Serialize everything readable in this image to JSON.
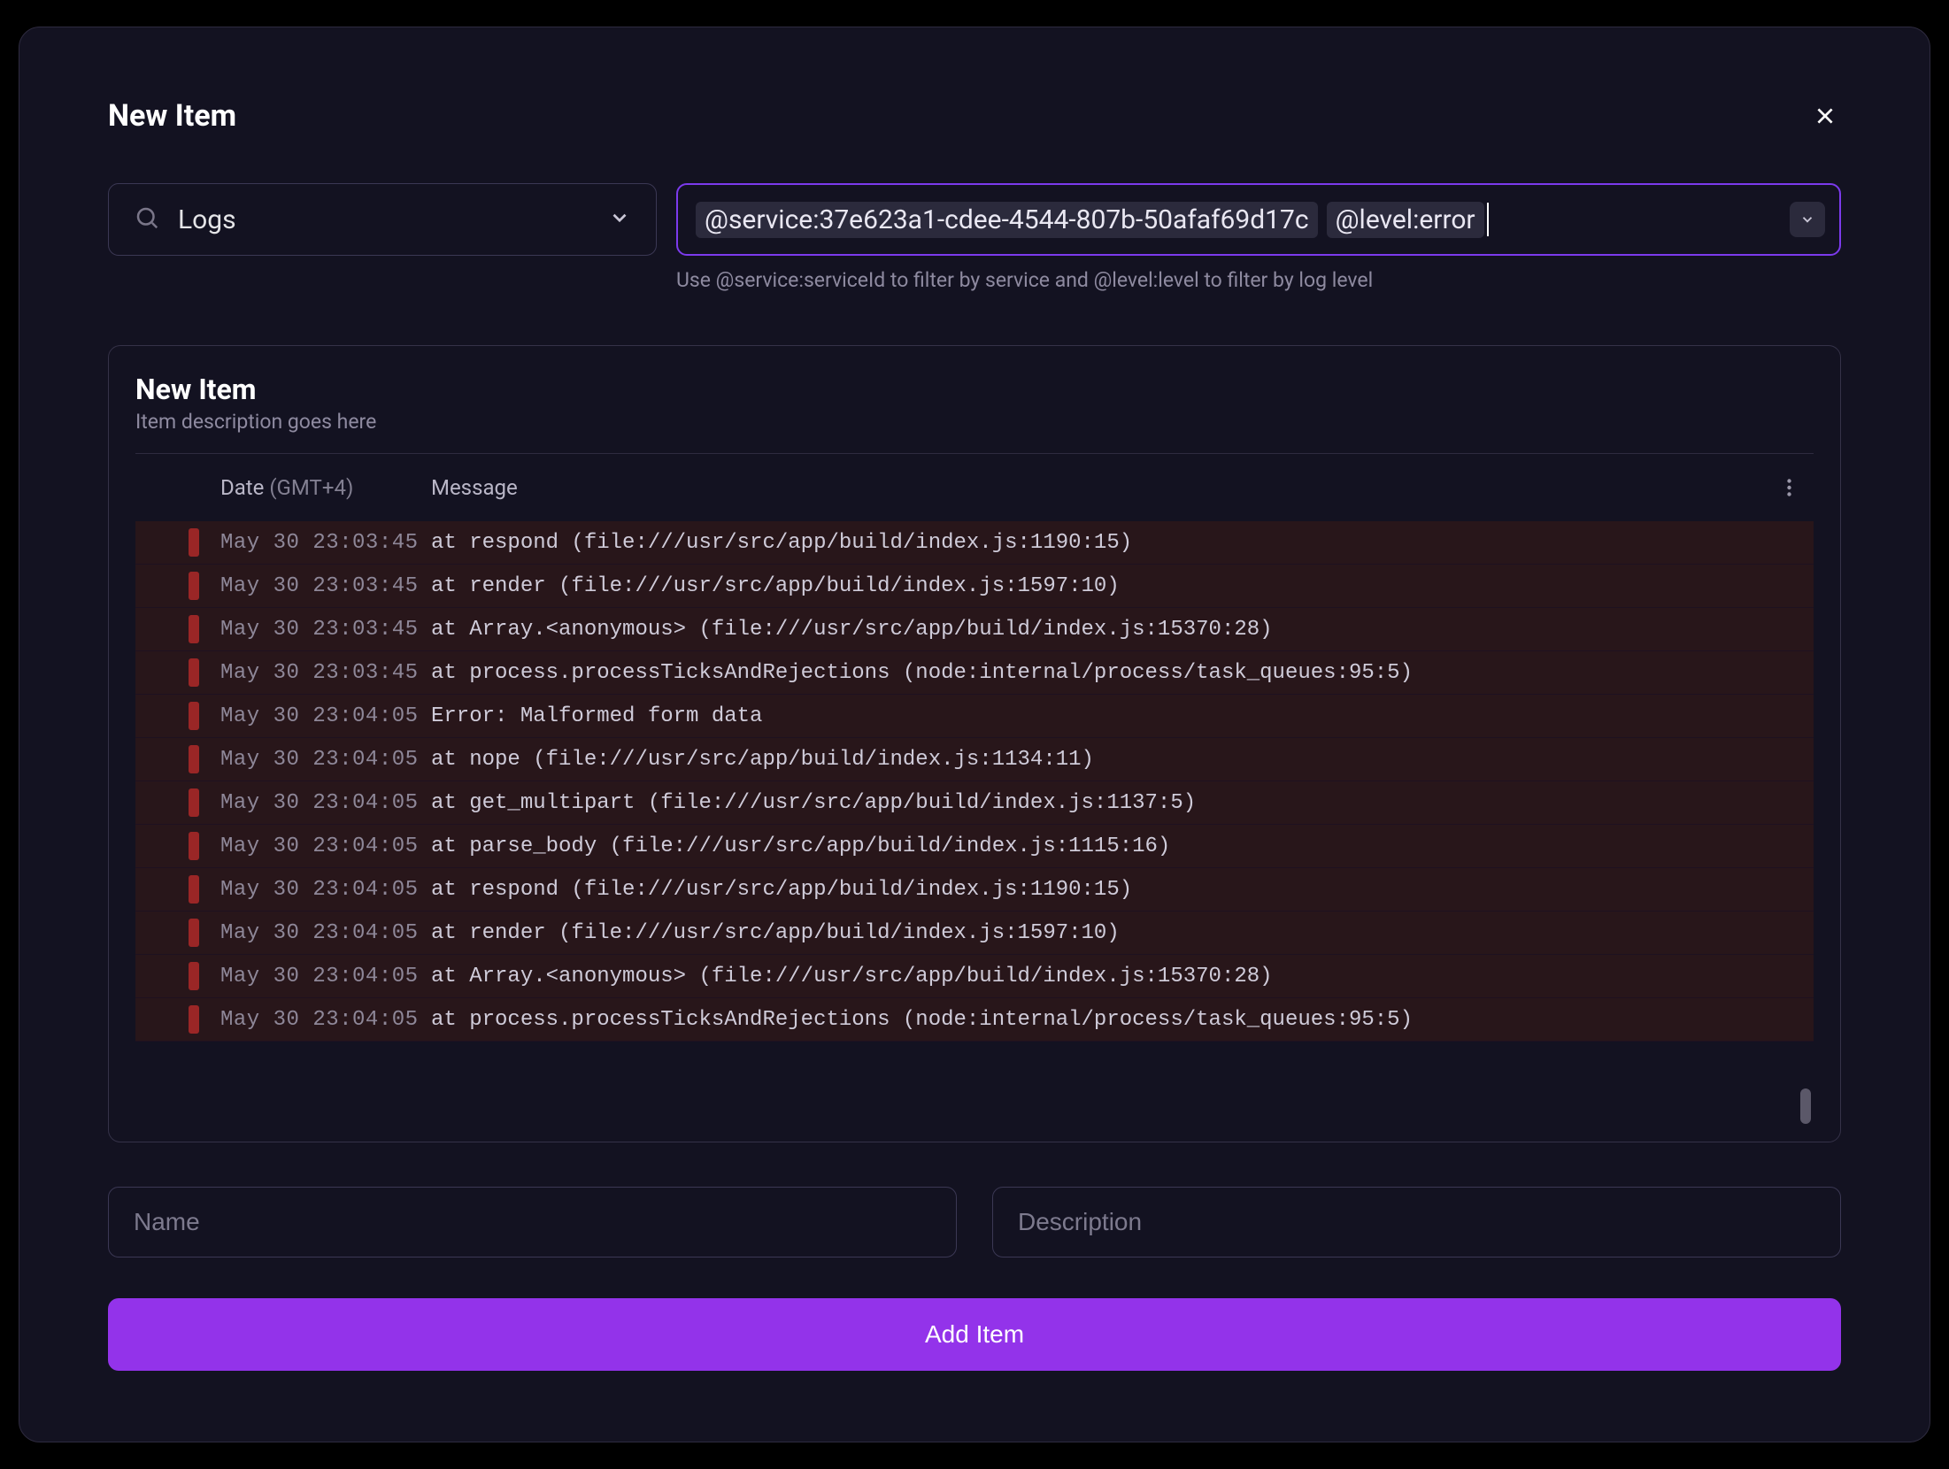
{
  "modal": {
    "title": "New Item"
  },
  "filters": {
    "type_value": "Logs",
    "query_chips": [
      "@service:37e623a1-cdee-4544-807b-50afaf69d17c",
      "@level:error"
    ],
    "hint": "Use @service:serviceId to filter by service and @level:level to filter by log level"
  },
  "preview": {
    "title": "New Item",
    "subtitle": "Item description goes here",
    "columns": {
      "date_label": "Date",
      "date_tz": "(GMT+4)",
      "message_label": "Message"
    },
    "rows": [
      {
        "ts": "May 30 23:03:45",
        "msg": "at respond (file:///usr/src/app/build/index.js:1190:15)"
      },
      {
        "ts": "May 30 23:03:45",
        "msg": "at render (file:///usr/src/app/build/index.js:1597:10)"
      },
      {
        "ts": "May 30 23:03:45",
        "msg": "at Array.<anonymous> (file:///usr/src/app/build/index.js:15370:28)"
      },
      {
        "ts": "May 30 23:03:45",
        "msg": "at process.processTicksAndRejections (node:internal/process/task_queues:95:5)"
      },
      {
        "ts": "May 30 23:04:05",
        "msg": "Error: Malformed form data"
      },
      {
        "ts": "May 30 23:04:05",
        "msg": "at nope (file:///usr/src/app/build/index.js:1134:11)"
      },
      {
        "ts": "May 30 23:04:05",
        "msg": "at get_multipart (file:///usr/src/app/build/index.js:1137:5)"
      },
      {
        "ts": "May 30 23:04:05",
        "msg": "at parse_body (file:///usr/src/app/build/index.js:1115:16)"
      },
      {
        "ts": "May 30 23:04:05",
        "msg": "at respond (file:///usr/src/app/build/index.js:1190:15)"
      },
      {
        "ts": "May 30 23:04:05",
        "msg": "at render (file:///usr/src/app/build/index.js:1597:10)"
      },
      {
        "ts": "May 30 23:04:05",
        "msg": "at Array.<anonymous> (file:///usr/src/app/build/index.js:15370:28)"
      },
      {
        "ts": "May 30 23:04:05",
        "msg": "at process.processTicksAndRejections (node:internal/process/task_queues:95:5)"
      }
    ]
  },
  "form": {
    "name_placeholder": "Name",
    "desc_placeholder": "Description",
    "submit_label": "Add Item"
  },
  "colors": {
    "accent": "#9333ea",
    "error_row": "#28161a",
    "error_sev": "#9a2626",
    "border": "#3b3854"
  }
}
